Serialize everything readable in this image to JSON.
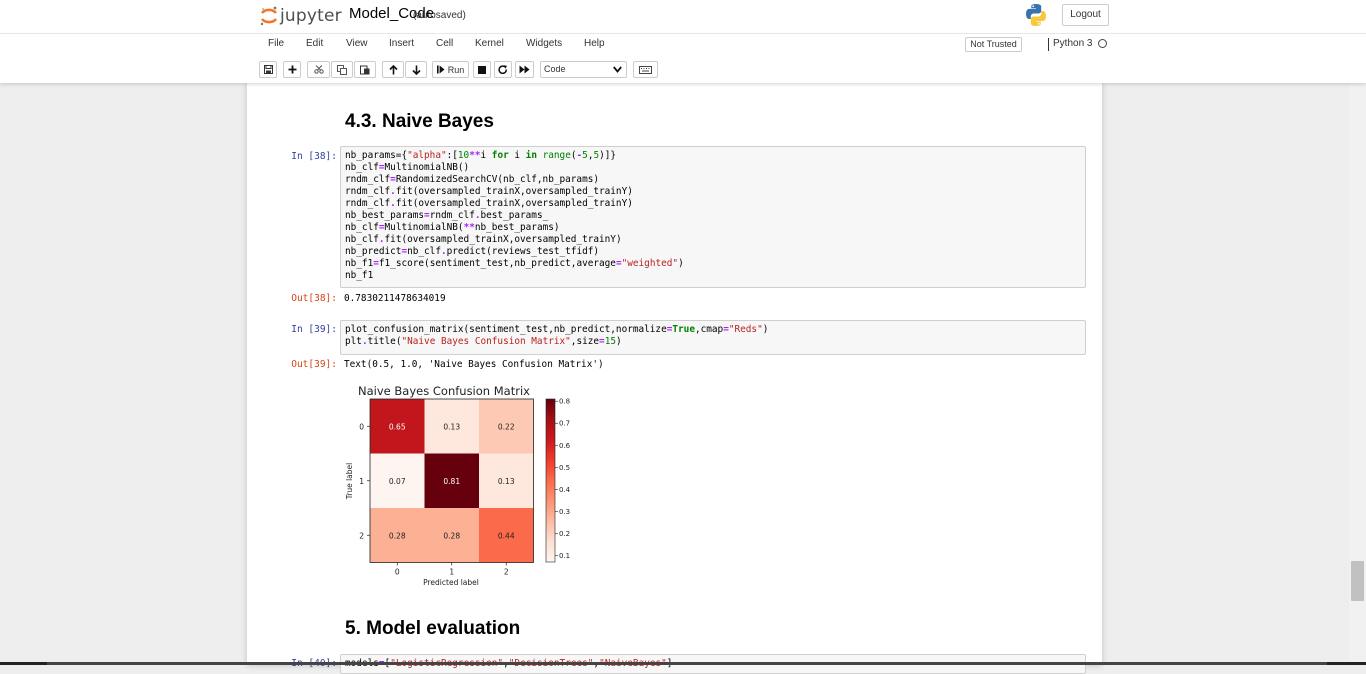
{
  "header": {
    "logo_text": "jupyter",
    "notebook_name": "Model_Code",
    "autosave_status": "(autosaved)",
    "logout_label": "Logout",
    "trust_label": "Not Trusted",
    "kernel_name": "Python 3"
  },
  "menu": {
    "items": [
      "File",
      "Edit",
      "View",
      "Insert",
      "Cell",
      "Kernel",
      "Widgets",
      "Help"
    ]
  },
  "toolbar": {
    "run_label": "Run",
    "cell_type": "Code",
    "icons": [
      "save-icon",
      "plus-icon",
      "cut-icon",
      "copy-icon",
      "paste-icon",
      "arrow-up-icon",
      "arrow-down-icon",
      "run-icon",
      "stop-icon",
      "restart-icon",
      "fast-forward-icon",
      "keyboard-icon"
    ]
  },
  "cells": {
    "heading_1": "4.3. Naive Bayes",
    "in_38": {
      "prompt": "In [38]:",
      "out_prompt": "Out[38]:",
      "output": "0.7830211478634019"
    },
    "in_39": {
      "prompt": "In [39]:",
      "out_prompt": "Out[39]:",
      "output": "Text(0.5, 1.0, 'Naive Bayes Confusion Matrix')"
    },
    "heading_2": "5. Model evaluation",
    "in_40": {
      "prompt": "In [40]:"
    }
  },
  "chart_data": {
    "type": "heatmap",
    "title": "Naive Bayes Confusion Matrix",
    "xlabel": "Predicted label",
    "ylabel": "True label",
    "x_categories": [
      "0",
      "1",
      "2"
    ],
    "y_categories": [
      "0",
      "1",
      "2"
    ],
    "values": [
      [
        0.65,
        0.13,
        0.22
      ],
      [
        0.07,
        0.81,
        0.13
      ],
      [
        0.28,
        0.28,
        0.44
      ]
    ],
    "colormap": "Reds",
    "colorbar_ticks": [
      "0.8",
      "0.7",
      "0.6",
      "0.5",
      "0.4",
      "0.3",
      "0.2",
      "0.1"
    ],
    "colorbar_range": [
      0.07,
      0.81
    ]
  }
}
